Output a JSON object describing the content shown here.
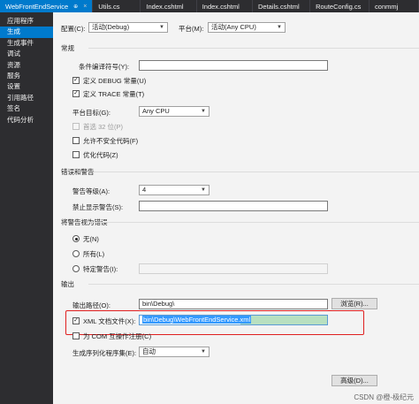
{
  "tabs": [
    {
      "label": "WebFrontEndService",
      "pin": "⊕",
      "close": "×",
      "active": true
    },
    {
      "label": "Utils.cs"
    },
    {
      "label": "Index.cshtml"
    },
    {
      "label": "Index.cshtml"
    },
    {
      "label": "Details.cshtml"
    },
    {
      "label": "RouteConfig.cs"
    },
    {
      "label": "conmmj"
    }
  ],
  "sidebar": {
    "items": [
      "应用程序",
      "生成",
      "生成事件",
      "调试",
      "资源",
      "服务",
      "设置",
      "引用路径",
      "签名",
      "代码分析"
    ],
    "active_index": 1
  },
  "config": {
    "config_label": "配置(C):",
    "config_value": "活动(Debug)",
    "platform_label": "平台(M):",
    "platform_value": "活动(Any CPU)"
  },
  "general": {
    "header": "常规",
    "conditional_symbols_label": "条件编译符号(Y):",
    "conditional_symbols_value": "",
    "define_debug_label": "定义 DEBUG 常量(U)",
    "define_trace_label": "定义 TRACE 常量(T)",
    "platform_target_label": "平台目标(G):",
    "platform_target_value": "Any CPU",
    "prefer32_label": "首选 32 位(P)",
    "unsafe_label": "允许不安全代码(F)",
    "optimize_label": "优化代码(Z)"
  },
  "errors": {
    "header": "错误和警告",
    "warning_level_label": "警告等级(A):",
    "warning_level_value": "4",
    "suppress_label": "禁止显示警告(S):",
    "suppress_value": ""
  },
  "treat_warnings": {
    "header": "将警告视为错误",
    "none_label": "无(N)",
    "all_label": "所有(L)",
    "specific_label": "特定警告(I):",
    "specific_value": ""
  },
  "output": {
    "header": "输出",
    "path_label": "输出路径(O):",
    "path_value": "bin\\Debug\\",
    "browse_label": "浏览(R)...",
    "xml_doc_label": "XML 文档文件(X):",
    "xml_doc_value": "bin\\Debug\\WebFrontEndService.xml",
    "com_label": "为 COM 互操作注册(C)",
    "serialization_label": "生成序列化程序集(E):",
    "serialization_value": "自动",
    "advanced_label": "高级(D)..."
  },
  "watermark": "CSDN @橙-极纪元",
  "colors": {
    "accent": "#007acc",
    "highlight_border": "#e02020",
    "selection": "#3399ff"
  }
}
